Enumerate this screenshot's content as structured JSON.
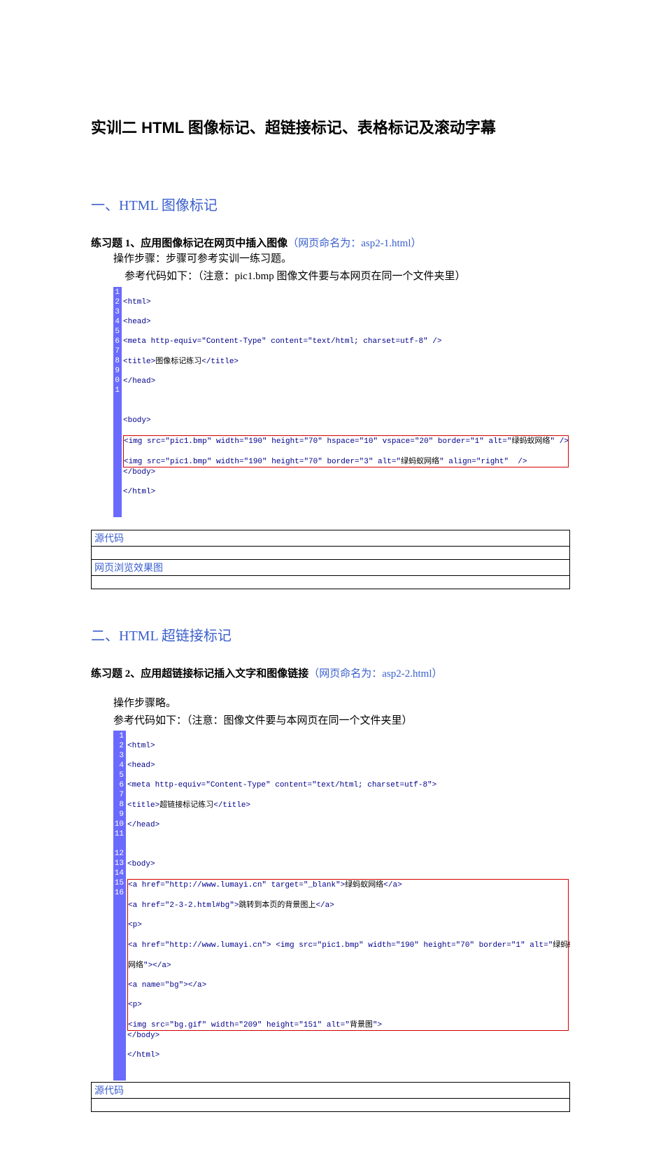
{
  "title": "实训二    HTML 图像标记、超链接标记、表格标记及滚动字幕",
  "section1": {
    "heading": "一、HTML 图像标记",
    "exercise": {
      "prefix": "练习题 1、应用图像标记在网页中插入图像",
      "filename": "（网页命名为：asp2-1.html）",
      "step_text": "操作步骤：步骤可参考实训一练习题。",
      "ref_text": "参考代码如下：（注意：pic1.bmp 图像文件要与本网页在同一个文件夹里）"
    },
    "code": {
      "nums": [
        "1",
        "2",
        "3",
        "4",
        "5",
        "6",
        "7",
        "8",
        "9",
        "0",
        "1"
      ],
      "l1": "<html>",
      "l2": "<head>",
      "l3": "<meta http-equiv=\"Content-Type\" content=\"text/html; charset=utf-8\" />",
      "l4a": "<title>",
      "l4b": "图像标记练习",
      "l4c": "</title>",
      "l5": "</head>",
      "l6": "",
      "l7": "<body>",
      "l8a": "<img src=\"pic1.bmp\" width=\"190\" height=\"70\" hspace=\"10\" vspace=\"20\" border=\"1\" alt=\"",
      "l8b": "绿蚂蚁网络",
      "l8c": "\" />",
      "l9a": "<img src=\"pic1.bmp\" width=\"190\" height=\"70\" border=\"3\" alt=\"",
      "l9b": "绿蚂蚁网络",
      "l9c": "\" align=\"right\"  />",
      "l10": "</body>",
      "l11": "</html>"
    },
    "table": {
      "r1": "源代码",
      "r2": "网页浏览效果图"
    }
  },
  "section2": {
    "heading": "二、HTML 超链接标记",
    "exercise": {
      "prefix": "练习题 2、应用超链接标记插入文字和图像链接",
      "filename": "（网页命名为：asp2-2.html）",
      "step_text": "操作步骤略。",
      "ref_text": "参考代码如下：（注意：图像文件要与本网页在同一个文件夹里）"
    },
    "code": {
      "nums": [
        "1",
        "2",
        "3",
        "4",
        "5",
        "6",
        "7",
        "8",
        "9",
        "10",
        "11",
        "",
        "12",
        "13",
        "14",
        "15",
        "16"
      ],
      "l1": "<html>",
      "l2": "<head>",
      "l3": "<meta http-equiv=\"Content-Type\" content=\"text/html; charset=utf-8\">",
      "l4a": "<title>",
      "l4b": "超链接标记练习",
      "l4c": "</title>",
      "l5": "</head>",
      "l6": "",
      "l7": "<body>",
      "l8a": "<a href=\"http://www.lumayi.cn\" target=\"_blank\">",
      "l8b": "绿蚂蚁网络",
      "l8c": "</a>",
      "l9a": "<a href=\"2-3-2.html#bg\">",
      "l9b": "跳转到本页的背景图上",
      "l9c": "</a>",
      "l10": "<p>",
      "l11a": "<a href=\"http://www.lumayi.cn\"> <img src=\"pic1.bmp\" width=\"190\" height=\"70\" border=\"1\" alt=\"",
      "l11b": "绿蚂蚁",
      "l11c": "网络",
      "l11d": "\"></a>",
      "l12": "<a name=\"bg\"></a>",
      "l13": "<p>",
      "l14a": "<img src=\"bg.gif\" width=\"209\" height=\"151\" alt=\"",
      "l14b": "背景图",
      "l14c": "\">",
      "l15": "</body>",
      "l16": "</html>"
    },
    "table": {
      "r1": "源代码"
    }
  }
}
